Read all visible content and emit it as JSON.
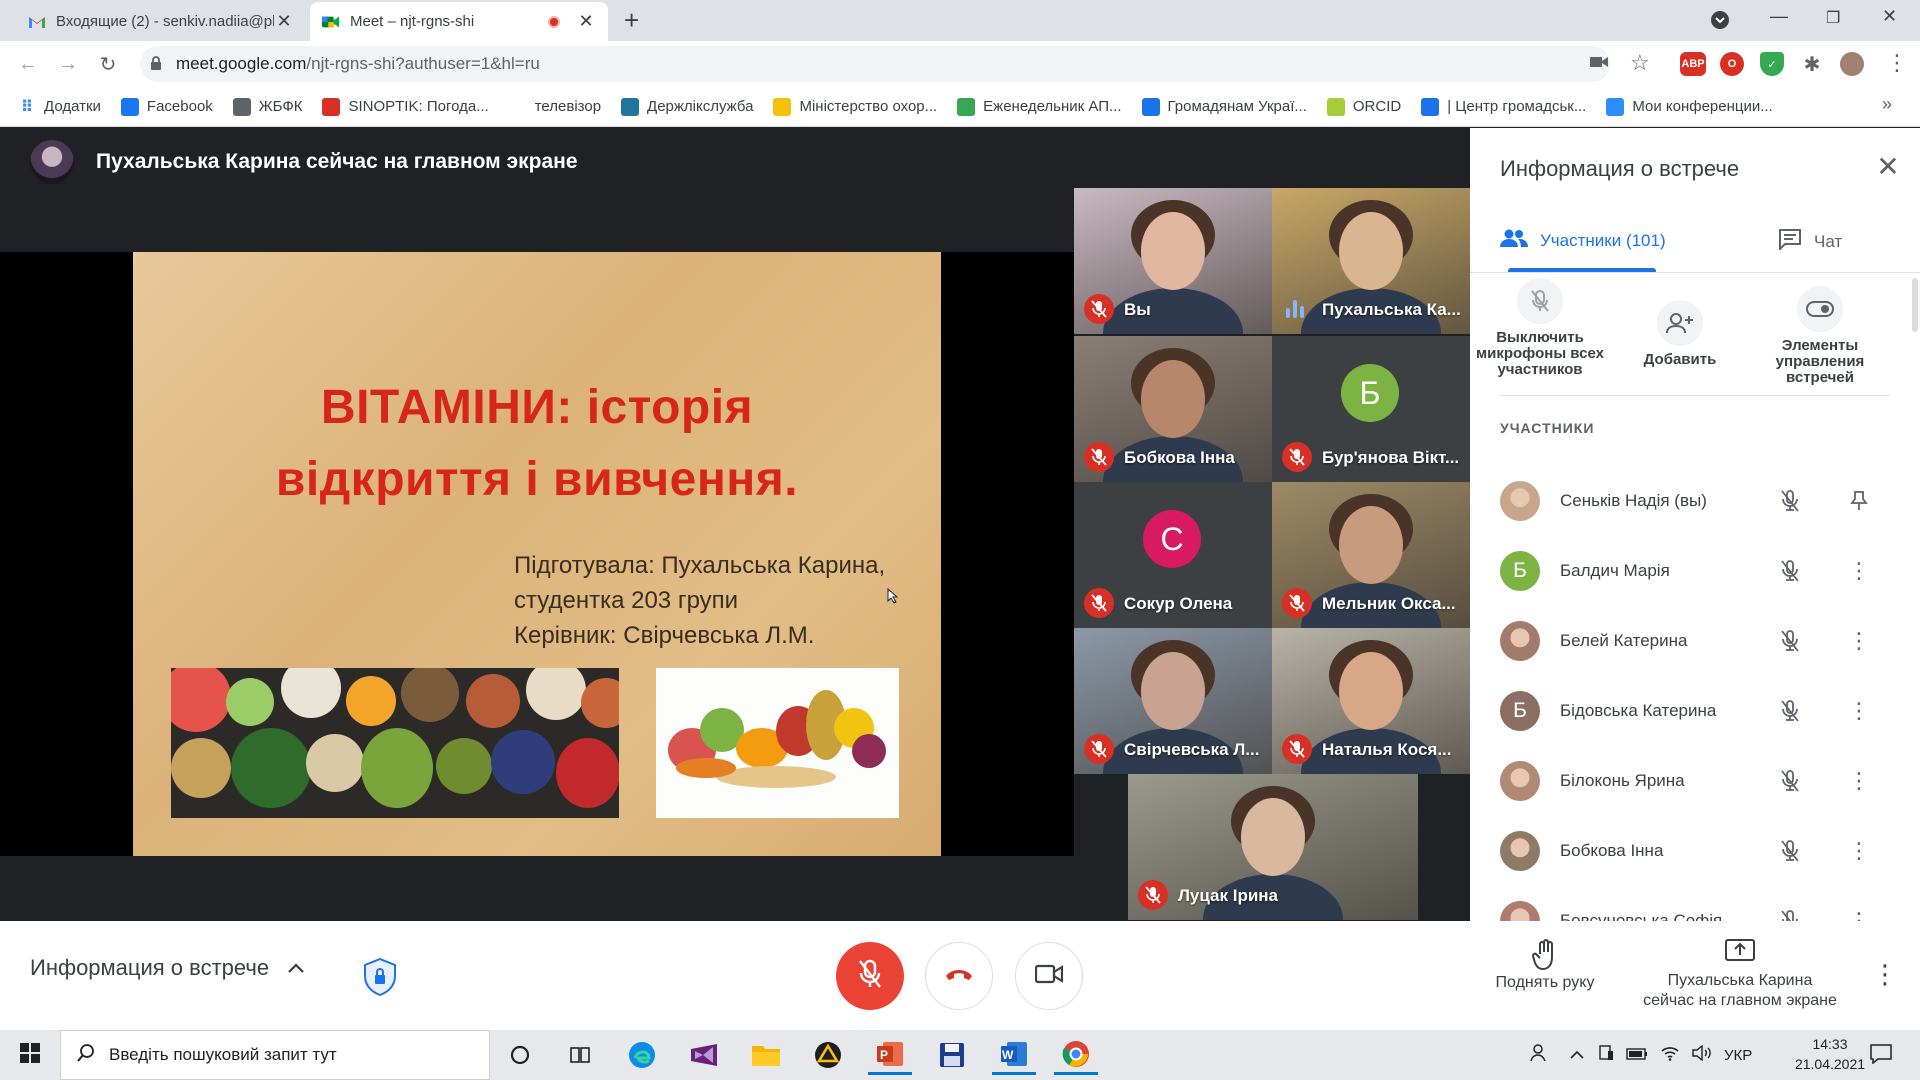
{
  "browser": {
    "tabs": [
      {
        "title": "Входящие (2) - senkiv.nadiia@pl",
        "state": "inactive",
        "icon": "gmail-icon"
      },
      {
        "title": "Meet – njt-rgns-shi",
        "state": "active",
        "icon": "meet-icon",
        "recording": true
      }
    ],
    "url_host": "meet.google.com",
    "url_path": "/njt-rgns-shi?authuser=1&hl=ru",
    "bookmarks": [
      {
        "label": "Додатки",
        "icon": "apps-grid-icon",
        "color": "#4285f4"
      },
      {
        "label": "Facebook",
        "icon": "facebook-icon",
        "color": "#1877f2"
      },
      {
        "label": "ЖБФК",
        "icon": "globe-icon",
        "color": "#5f6368"
      },
      {
        "label": "SINOPTIK: Погода...",
        "icon": "thermometer-icon",
        "color": "#d93025"
      },
      {
        "label": "телевізор",
        "icon": "blank-icon",
        "color": "#ffffff"
      },
      {
        "label": "Держлікслужба",
        "icon": "wordpress-icon",
        "color": "#21759b"
      },
      {
        "label": "Міністерство охор...",
        "icon": "trident-icon",
        "color": "#f4c20d"
      },
      {
        "label": "Еженедельник АП...",
        "icon": "green-cross-icon",
        "color": "#34a853"
      },
      {
        "label": "Громадянам Украї...",
        "icon": "emblem-icon",
        "color": "#1a73e8"
      },
      {
        "label": "ORCID",
        "icon": "orcid-icon",
        "color": "#a6ce39"
      },
      {
        "label": "| Центр громадськ...",
        "icon": "compass-icon",
        "color": "#1a73e8"
      },
      {
        "label": "Мои конференции...",
        "icon": "zoom-icon",
        "color": "#2d8cff"
      }
    ]
  },
  "meet": {
    "presenter_banner": "Пухальська Карина сейчас на главном экране",
    "slide": {
      "title_line1": "ВІТАМІНИ: історія",
      "title_line2": "відкриття і вивчення.",
      "author_line1": "Підготувала: Пухальська Карина,",
      "author_line2": "студентка 203 групи",
      "author_line3": "Керівник: Свірчевська Л.М."
    },
    "tiles": [
      {
        "name": "Вы",
        "muted": true,
        "kind": "video",
        "bg": "#c9b9c2",
        "face": "#e2b7a2"
      },
      {
        "name": "Пухальська Ка...",
        "muted": false,
        "speaking": true,
        "kind": "video",
        "bg": "#c8a867",
        "face": "#d9b68f"
      },
      {
        "name": "Бобкова Інна",
        "muted": true,
        "kind": "video",
        "bg": "#8a7f77",
        "face": "#b8866a"
      },
      {
        "name": "Бур'янова Вікт...",
        "muted": true,
        "kind": "letter",
        "letter": "Б",
        "color": "#7cb342"
      },
      {
        "name": "Сокур Олена",
        "muted": true,
        "kind": "letter",
        "letter": "С",
        "color": "#d81b60"
      },
      {
        "name": "Мельник Окса...",
        "muted": true,
        "kind": "video",
        "bg": "#9e8a66",
        "face": "#c69c7d"
      },
      {
        "name": "Свірчевська Л...",
        "muted": true,
        "kind": "video",
        "bg": "#8c99a8",
        "face": "#c8a391"
      },
      {
        "name": "Наталья Кося...",
        "muted": true,
        "kind": "video",
        "bg": "#b9b3a8",
        "face": "#d7a787"
      },
      {
        "name": "Луцак Ірина",
        "muted": true,
        "kind": "video",
        "bg": "#9a9a8d",
        "face": "#d8b89e"
      }
    ]
  },
  "panel": {
    "title": "Информация о встрече",
    "tab_people": "Участники (101)",
    "tab_chat": "Чат",
    "action_mute_all": "Выключить микрофоны всех участников",
    "action_add": "Добавить",
    "action_controls": "Элементы управления встречей",
    "section_label": "УЧАСТНИКИ",
    "participants": [
      {
        "name": "Сеньків Надія (вы)",
        "avatar": "photo",
        "color": "#c9a58c",
        "action": "pin-icon"
      },
      {
        "name": "Балдич Марія",
        "avatar": "letter",
        "letter": "Б",
        "color": "#7cb342",
        "action": "more-icon"
      },
      {
        "name": "Белей Катерина",
        "avatar": "photo",
        "color": "#a37b6a",
        "action": "more-icon"
      },
      {
        "name": "Бідовська Катерина",
        "avatar": "letter",
        "letter": "Б",
        "color": "#8d6e63",
        "action": "more-icon"
      },
      {
        "name": "Білоконь Ярина",
        "avatar": "photo",
        "color": "#b08a74",
        "action": "more-icon"
      },
      {
        "name": "Бобкова Інна",
        "avatar": "photo",
        "color": "#8f7a68",
        "action": "more-icon"
      },
      {
        "name": "Бовсуновська Софія",
        "avatar": "photo",
        "color": "#b07a70",
        "action": "more-icon"
      }
    ]
  },
  "callbar": {
    "meeting_info": "Информация о встрече",
    "raise_hand": "Поднять руку",
    "presenting_line1": "Пухальська Карина",
    "presenting_line2": "сейчас на главном экране"
  },
  "taskbar": {
    "search_placeholder": "Введіть пошуковий запит тут",
    "language": "УКР",
    "time": "14:33",
    "date": "21.04.2021"
  },
  "colors": {
    "accent": "#1a73e8",
    "danger": "#ea4335",
    "slide_title": "#d6261c"
  }
}
